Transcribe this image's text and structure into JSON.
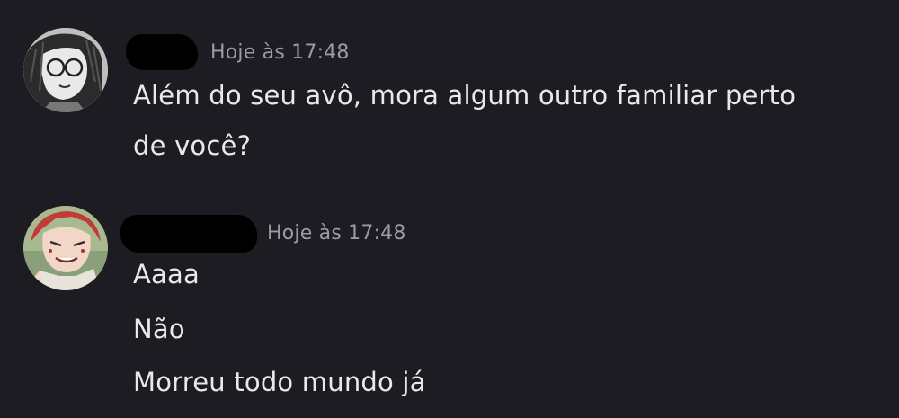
{
  "messages": [
    {
      "username": "",
      "timestamp": "Hoje às 17:48",
      "lines": [
        "Além do seu avô, mora algum outro familiar perto",
        "de você?"
      ]
    },
    {
      "username": "",
      "timestamp": "Hoje às 17:48",
      "lines": [
        "Aaaa",
        "Não",
        "Morreu todo mundo já"
      ]
    }
  ],
  "colors": {
    "background": "#1c1c22",
    "text": "#e8e9ec",
    "timestamp": "#9a9ca4",
    "redaction": "#000000"
  },
  "icons": {
    "avatar_1": "user-avatar-manga-glasses",
    "avatar_2": "user-avatar-anime-redhair"
  }
}
